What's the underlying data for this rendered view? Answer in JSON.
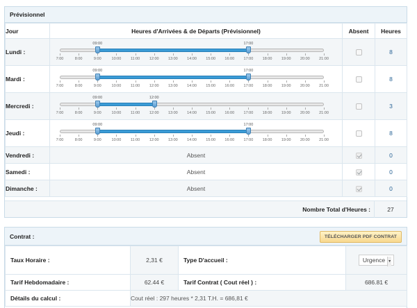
{
  "previsionnel": {
    "title": "Prévisionnel",
    "headers": {
      "jour": "Jour",
      "heures_arrivees": "Heures d'Arrivées & de Départs (Prévisionnel)",
      "absent": "Absent",
      "heures": "Heures"
    },
    "tick_labels": [
      "7:00",
      "8:00",
      "9:00",
      "10:00",
      "11:00",
      "12:00",
      "13:00",
      "14:00",
      "15:00",
      "16:00",
      "17:00",
      "18:00",
      "19:00",
      "20:00",
      "21:00"
    ],
    "slider_range": {
      "min": 7,
      "max": 21
    },
    "days": [
      {
        "name": "Lundi :",
        "start": 9,
        "end": 17,
        "start_label": "09:00",
        "end_label": "17:00",
        "absent": false,
        "hours": "8"
      },
      {
        "name": "Mardi :",
        "start": 9,
        "end": 17,
        "start_label": "09:00",
        "end_label": "17:00",
        "absent": false,
        "hours": "8"
      },
      {
        "name": "Mercredi :",
        "start": 9,
        "end": 12,
        "start_label": "09:00",
        "end_label": "12:00",
        "absent": false,
        "hours": "3"
      },
      {
        "name": "Jeudi :",
        "start": 9,
        "end": 17,
        "start_label": "09:00",
        "end_label": "17:00",
        "absent": false,
        "hours": "8"
      },
      {
        "name": "Vendredi :",
        "absent": true,
        "absent_text": "Absent",
        "hours": "0"
      },
      {
        "name": "Samedi :",
        "absent": true,
        "absent_text": "Absent",
        "hours": "0"
      },
      {
        "name": "Dimanche :",
        "absent": true,
        "absent_text": "Absent",
        "hours": "0"
      }
    ],
    "total_label": "Nombre Total d'Heures :",
    "total_value": "27"
  },
  "contrat": {
    "title": "Contrat :",
    "download_label": "TÉLÉCHARGER PDF CONTRAT",
    "taux_horaire_label": "Taux Horaire :",
    "taux_horaire_value": "2,31 €",
    "type_accueil_label": "Type D'accueil :",
    "type_accueil_value": "Urgence",
    "tarif_hebdo_label": "Tarif Hebdomadaire :",
    "tarif_hebdo_value": "62.44 €",
    "tarif_contrat_label": "Tarif Contrat ( Cout réel ) :",
    "tarif_contrat_value": "686.81 €",
    "details_label": "Détails du calcul :",
    "details_value": "Cout réel : 297 heures * 2,31 T.H. = 686,81 €"
  },
  "colors": {
    "accent": "#3a9bd6",
    "header_bg": "#edf4f9",
    "button_bg": "#f8d88f",
    "link": "#2a6496"
  }
}
